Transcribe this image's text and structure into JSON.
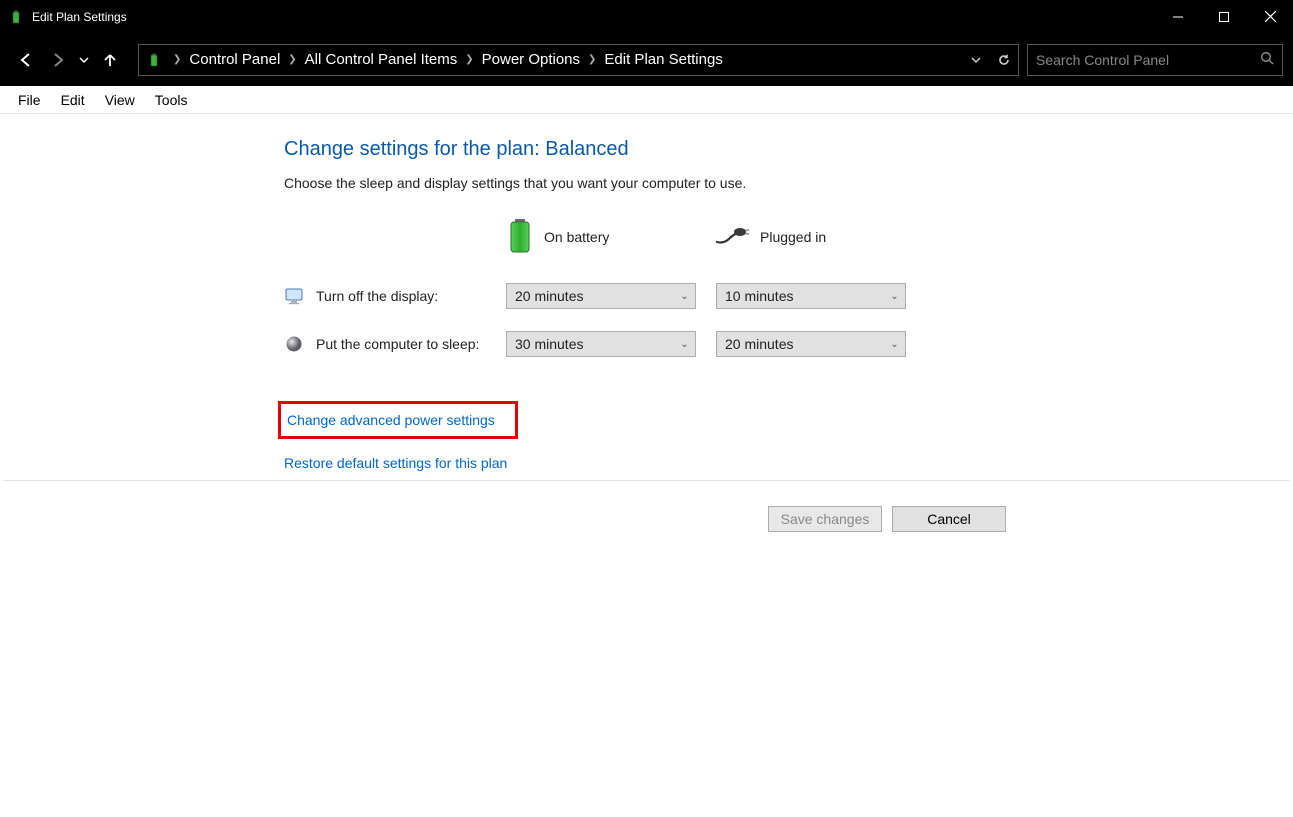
{
  "window": {
    "title": "Edit Plan Settings"
  },
  "breadcrumb": {
    "items": [
      "Control Panel",
      "All Control Panel Items",
      "Power Options",
      "Edit Plan Settings"
    ]
  },
  "search": {
    "placeholder": "Search Control Panel"
  },
  "menu": {
    "items": [
      "File",
      "Edit",
      "View",
      "Tools"
    ]
  },
  "page": {
    "title": "Change settings for the plan: Balanced",
    "subtitle": "Choose the sleep and display settings that you want your computer to use."
  },
  "columns": {
    "battery": "On battery",
    "plugged": "Plugged in"
  },
  "rows": {
    "display": {
      "label": "Turn off the display:",
      "battery": "20 minutes",
      "plugged": "10 minutes"
    },
    "sleep": {
      "label": "Put the computer to sleep:",
      "battery": "30 minutes",
      "plugged": "20 minutes"
    }
  },
  "links": {
    "advanced": "Change advanced power settings",
    "restore": "Restore default settings for this plan"
  },
  "buttons": {
    "save": "Save changes",
    "cancel": "Cancel"
  }
}
